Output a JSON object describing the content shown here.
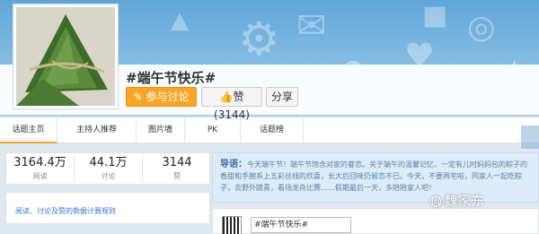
{
  "topic": {
    "title": "#端午节快乐#",
    "join_label": "参与讨论",
    "like_label": "赞(3144)",
    "share_label": "分享"
  },
  "tabs": [
    "话题主页",
    "主持人推荐",
    "图片墙",
    "PK",
    "话题榜"
  ],
  "stats": [
    {
      "value": "3164.4万",
      "label": "阅读"
    },
    {
      "value": "44.1万",
      "label": "讨论"
    },
    {
      "value": "3144",
      "label": "赞"
    }
  ],
  "rules_link": "阅读、讨论及赞的数据计算规则",
  "guide": {
    "label": "导语：",
    "text": "今天端午节！端午节饱含对家的眷恋。关于端午的温馨记忆，一定有儿时妈妈包的粽子的香甜和手腕系上五彩丝线的欣喜，长大后回味仍留恋不已。今天，不要再宅啦，同家人一起吃粽子，去野外踏青，看场龙舟比赛……假期最后一天，多陪陪家人吧！"
  },
  "compose": {
    "input_value": "#端午节快乐#"
  },
  "watermark": "魏家东",
  "colors": {
    "accent": "#f7a627",
    "banner": "#6aaedc",
    "link": "#3a76c0"
  }
}
